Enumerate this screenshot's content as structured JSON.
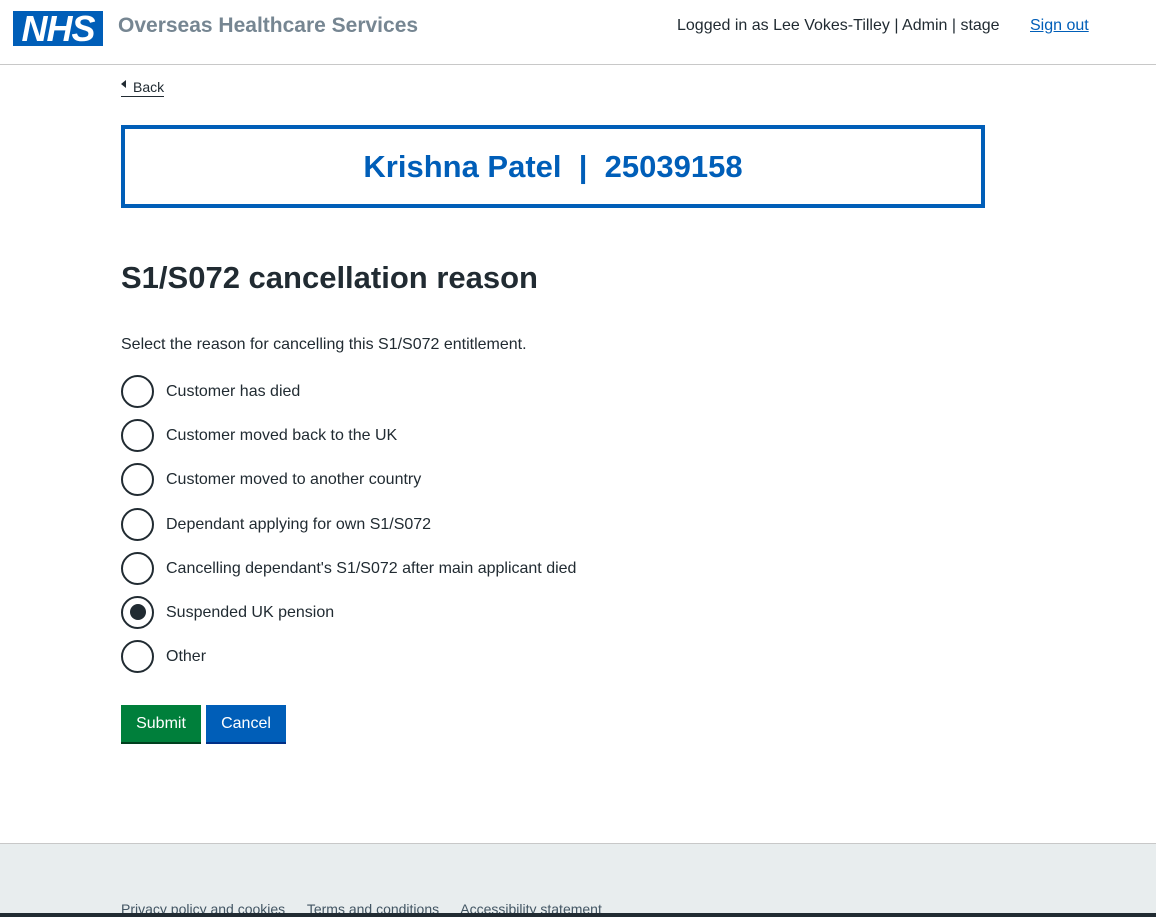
{
  "header": {
    "logo_text": "NHS",
    "service_name": "Overseas Healthcare Services",
    "user_info": "Logged in as Lee Vokes-Tilley | Admin | stage",
    "sign_out": "Sign out"
  },
  "back_link": "Back",
  "patient_banner": "Krishna Patel  |  25039158",
  "page": {
    "heading": "S1/S072 cancellation reason",
    "hint": "Select the reason for cancelling this S1/S072 entitlement.",
    "selected_option": "Suspended UK pension",
    "options": [
      {
        "label": "Customer has died"
      },
      {
        "label": "Customer moved back to the UK"
      },
      {
        "label": "Customer moved to another country"
      },
      {
        "label": "Dependant applying for own S1/S072"
      },
      {
        "label": "Cancelling dependant's S1/S072 after main applicant died"
      },
      {
        "label": "Suspended UK pension"
      },
      {
        "label": "Other"
      }
    ]
  },
  "buttons": {
    "submit": "Submit",
    "cancel": "Cancel"
  },
  "footer": {
    "links": [
      "Privacy policy and cookies",
      "Terms and conditions",
      "Accessibility statement"
    ]
  },
  "colors": {
    "nhs_blue": "#005eb8",
    "nhs_green": "#007f3b",
    "text": "#212b32",
    "footer_bg": "#e8edee"
  }
}
